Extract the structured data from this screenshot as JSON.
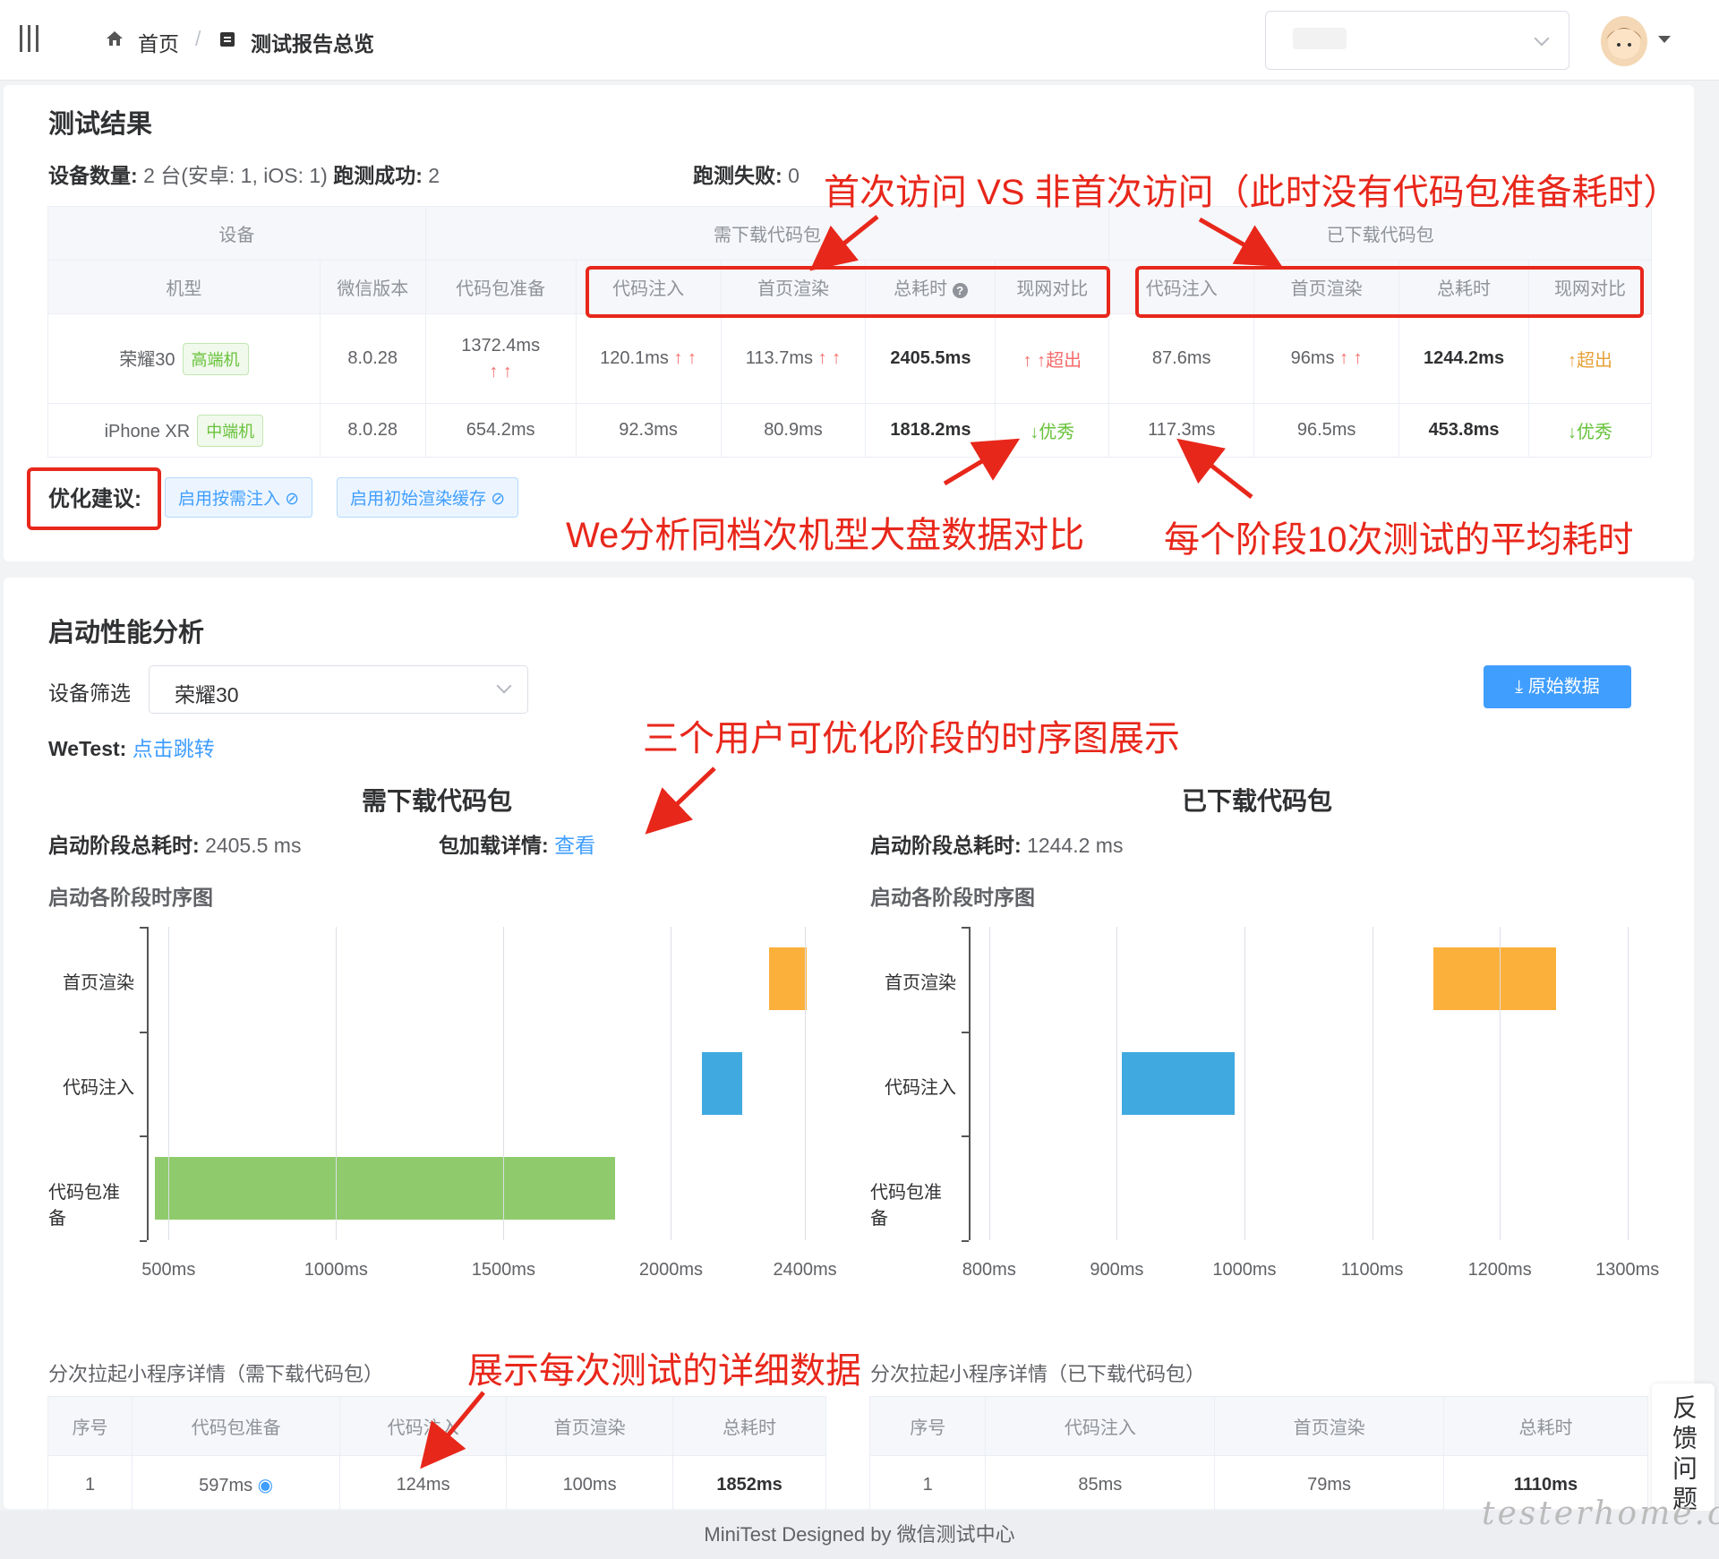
{
  "header": {
    "breadcrumb": [
      {
        "label": "首页",
        "icon": "home-icon"
      },
      {
        "label": "测试报告总览",
        "icon": "report-icon"
      }
    ]
  },
  "summary": {
    "title": "测试结果",
    "device_count_label": "设备数量:",
    "device_count_value": "2 台(安卓: 1, iOS: 1)",
    "success_label": "跑测成功:",
    "success_value": "2",
    "fail_label": "跑测失败:",
    "fail_value": "0"
  },
  "table": {
    "group_headers": [
      "设备",
      "需下载代码包",
      "已下载代码包"
    ],
    "columns": [
      "机型",
      "微信版本",
      "代码包准备",
      "代码注入",
      "首页渲染",
      "总耗时",
      "现网对比",
      "代码注入",
      "首页渲染",
      "总耗时",
      "现网对比"
    ],
    "rows": [
      {
        "model": "荣耀30",
        "tag": "高端机",
        "wx": "8.0.28",
        "prep": "1372.4ms",
        "prep_arrow": "↑ ↑",
        "inject": "120.1ms",
        "inject_arrow": "↑ ↑",
        "render": "113.7ms",
        "render_arrow": "↑ ↑",
        "total": "2405.5ms",
        "compare": "↑ ↑超出",
        "inject2": "87.6ms",
        "render2": "96ms",
        "render2_arrow": "↑ ↑",
        "total2": "1244.2ms",
        "compare2": "↑超出"
      },
      {
        "model": "iPhone XR",
        "tag": "中端机",
        "wx": "8.0.28",
        "prep": "654.2ms",
        "inject": "92.3ms",
        "render": "80.9ms",
        "total": "1818.2ms",
        "compare": "↓优秀",
        "inject2": "117.3ms",
        "render2": "96.5ms",
        "total2": "453.8ms",
        "compare2": "↓优秀"
      }
    ]
  },
  "suggest": {
    "label": "优化建议:",
    "buttons": [
      "启用按需注入",
      "启用初始渲染缓存"
    ]
  },
  "annotations": {
    "a1": "首次访问 VS 非首次访问（此时没有代码包准备耗时）",
    "a2": "We分析同档次机型大盘数据对比",
    "a3": "每个阶段10次测试的平均耗时",
    "a4": "三个用户可优化阶段的时序图展示",
    "a5": "展示每次测试的详细数据"
  },
  "perf": {
    "title": "启动性能分析",
    "filter_label": "设备筛选",
    "filter_value": "荣耀30",
    "download_btn": "原始数据",
    "wetest_label": "WeTest:",
    "wetest_link": "点击跳转",
    "left": {
      "title": "需下载代码包",
      "total_label": "启动阶段总耗时:",
      "total_value": "2405.5 ms",
      "pkg_label": "包加载详情:",
      "pkg_link": "查看",
      "chart_title": "启动各阶段时序图"
    },
    "right": {
      "title": "已下载代码包",
      "total_label": "启动阶段总耗时:",
      "total_value": "1244.2 ms",
      "chart_title": "启动各阶段时序图"
    }
  },
  "chart_data": [
    {
      "type": "bar",
      "orientation": "horizontal",
      "subtype": "gantt",
      "categories": [
        "首页渲染",
        "代码注入",
        "代码包准备"
      ],
      "series": [
        {
          "values": [
            [
              2292,
              2406
            ],
            [
              2092,
              2212
            ],
            [
              460,
              1832
            ]
          ]
        }
      ],
      "xticks": [
        "500ms",
        "1000ms",
        "1500ms",
        "2000ms",
        "2400ms"
      ],
      "colors": [
        "#fbb03b",
        "#3fa9e0",
        "#8fcb6c"
      ]
    },
    {
      "type": "bar",
      "orientation": "horizontal",
      "subtype": "gantt",
      "categories": [
        "首页渲染",
        "代码注入",
        "代码包准备"
      ],
      "series": [
        {
          "values": [
            [
              1148,
              1244
            ],
            [
              904,
              992
            ],
            null
          ]
        }
      ],
      "xticks": [
        "800ms",
        "900ms",
        "1000ms",
        "1100ms",
        "1200ms",
        "1300ms"
      ],
      "colors": [
        "#fbb03b",
        "#3fa9e0",
        "#8fcb6c"
      ]
    }
  ],
  "details": {
    "left": {
      "title": "分次拉起小程序详情（需下载代码包）",
      "columns": [
        "序号",
        "代码包准备",
        "代码注入",
        "首页渲染",
        "总耗时"
      ],
      "rows": [
        [
          "1",
          "597ms",
          "124ms",
          "100ms",
          "1852ms"
        ]
      ]
    },
    "right": {
      "title": "分次拉起小程序详情（已下载代码包）",
      "columns": [
        "序号",
        "代码注入",
        "首页渲染",
        "总耗时"
      ],
      "rows": [
        [
          "1",
          "85ms",
          "79ms",
          "1110ms"
        ]
      ]
    }
  },
  "footer": {
    "text": "MiniTest Designed by 微信测试中心"
  },
  "feedback": {
    "text": "反馈问题"
  },
  "watermark": "testerhome.com"
}
